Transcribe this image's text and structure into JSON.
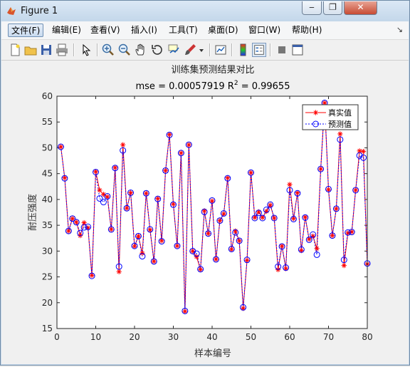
{
  "window": {
    "title": "Figure 1",
    "minimize_label": "‒",
    "restore_label": "❐",
    "close_label": "✕"
  },
  "menu": {
    "items": [
      "文件(F)",
      "编辑(E)",
      "查看(V)",
      "插入(I)",
      "工具(T)",
      "桌面(D)",
      "窗口(W)",
      "帮助(H)"
    ],
    "overflow": "↘"
  },
  "toolbar": {
    "icons": [
      "new-figure-icon",
      "open-file-icon",
      "save-icon",
      "print-icon",
      "edit-plot-arrow-icon",
      "zoom-in-icon",
      "zoom-out-icon",
      "pan-hand-icon",
      "rotate-3d-icon",
      "data-cursor-icon",
      "brush-icon",
      "brush-dropdown-icon",
      "link-plot-icon",
      "colorbar-icon",
      "legend-icon",
      "hide-plot-tools-icon",
      "show-plot-tools-icon"
    ]
  },
  "chart_data": {
    "type": "line",
    "title": "训练集预测结果对比",
    "subtitle_prefix": "mse = 0.00057919 R",
    "subtitle_sup": "2",
    "subtitle_suffix": " = 0.99655",
    "xlabel": "样本编号",
    "ylabel": "耐压强度",
    "xlim": [
      0,
      80
    ],
    "ylim": [
      15,
      60
    ],
    "xticks": [
      0,
      10,
      20,
      30,
      40,
      50,
      60,
      70,
      80
    ],
    "yticks": [
      15,
      20,
      25,
      30,
      35,
      40,
      45,
      50,
      55,
      60
    ],
    "grid": false,
    "legend_position": "top-right",
    "series": [
      {
        "name": "真实值",
        "color": "#ff0000",
        "marker": "*",
        "values": [
          50.2,
          44.2,
          33.9,
          36.3,
          35.6,
          33.0,
          35.5,
          34.5,
          25.3,
          45.4,
          41.8,
          41.0,
          40.5,
          34.2,
          46.2,
          26.0,
          50.6,
          38.3,
          41.3,
          30.9,
          32.9,
          29.6,
          41.2,
          34.1,
          28.0,
          40.2,
          32.0,
          45.6,
          52.6,
          39.1,
          31.0,
          49.0,
          18.3,
          50.6,
          30.0,
          28.9,
          26.4,
          37.8,
          33.4,
          39.7,
          28.4,
          35.9,
          37.2,
          44.2,
          30.3,
          33.9,
          32.0,
          18.9,
          28.2,
          45.2,
          36.5,
          37.6,
          36.5,
          37.7,
          38.9,
          36.4,
          26.4,
          31.0,
          26.6,
          42.9,
          36.3,
          41.3,
          30.1,
          36.6,
          32.3,
          32.9,
          30.5,
          45.9,
          58.7,
          41.9,
          33.0,
          38.2,
          52.7,
          27.2,
          33.5,
          33.7,
          41.8,
          49.4,
          49.3,
          27.5
        ]
      },
      {
        "name": "预测值",
        "color": "#0000ff",
        "marker": "o",
        "values": [
          50.2,
          44.1,
          33.9,
          36.3,
          35.6,
          33.5,
          34.6,
          34.7,
          25.2,
          45.3,
          40.2,
          39.5,
          40.6,
          34.2,
          46.1,
          27.0,
          49.5,
          38.3,
          41.3,
          31.0,
          32.9,
          29.0,
          41.2,
          34.2,
          28.0,
          40.1,
          31.9,
          45.6,
          52.5,
          39.0,
          31.0,
          49.0,
          18.4,
          50.6,
          30.0,
          29.5,
          26.5,
          37.6,
          33.4,
          39.8,
          28.4,
          35.9,
          37.3,
          44.1,
          30.4,
          33.6,
          32.0,
          19.1,
          28.3,
          45.2,
          36.4,
          37.4,
          36.4,
          38.0,
          39.0,
          36.4,
          27.0,
          30.9,
          26.8,
          41.8,
          36.2,
          41.2,
          30.3,
          36.5,
          32.2,
          33.2,
          29.3,
          45.9,
          58.7,
          42.0,
          33.0,
          38.2,
          51.6,
          28.3,
          33.6,
          33.7,
          41.8,
          48.5,
          48.1,
          27.6
        ]
      }
    ]
  }
}
